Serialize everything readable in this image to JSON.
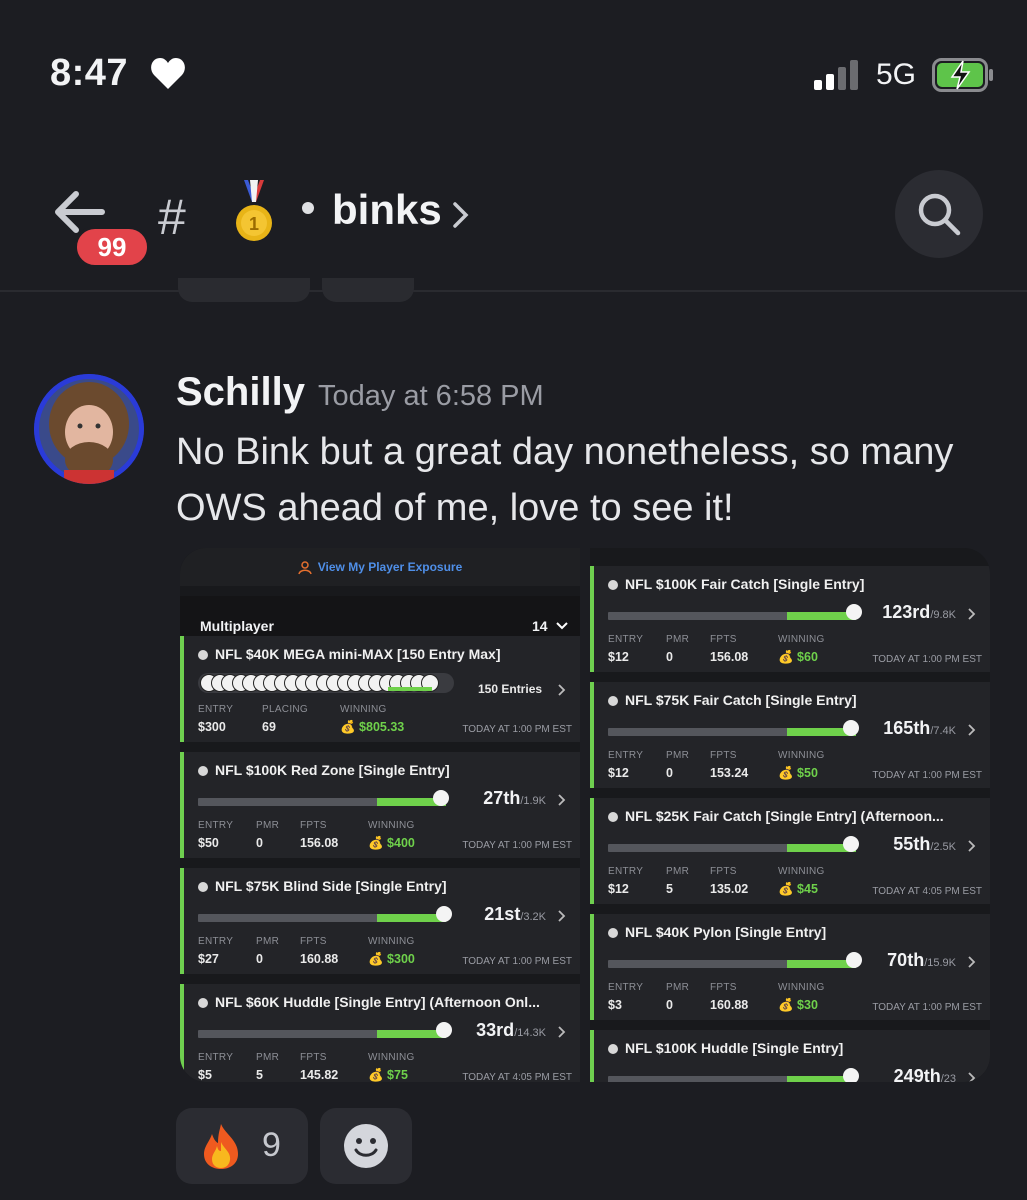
{
  "status_bar": {
    "time": "8:47",
    "network": "5G"
  },
  "header": {
    "unread_badge": "99",
    "hash": "#",
    "channel": "binks"
  },
  "message": {
    "author": "Schilly",
    "timestamp": "Today at 6:58 PM",
    "text": "No Bink but a great day nonetheless, so many OWS ahead of me, love to see it!"
  },
  "screenshot": {
    "exposure_link": "View My Player Exposure",
    "section_label": "Multiplayer",
    "section_count": "14",
    "left_cards": [
      {
        "title": "NFL $40K MEGA mini-MAX [150 Entry Max]",
        "entries": "150 Entries",
        "entry_label": "ENTRY",
        "entry": "$300",
        "mid_label": "PLACING",
        "mid": "69",
        "win_label": "WINNING",
        "winning": "💰 $805.33",
        "when": "TODAY AT 1:00 PM EST"
      },
      {
        "title": "NFL $100K Red Zone [Single Entry]",
        "rank": "27th",
        "field": "/1.9K",
        "progress": 0.98,
        "entry_label": "ENTRY",
        "entry": "$50",
        "pmr_label": "PMR",
        "pmr": "0",
        "fpts_label": "FPTS",
        "fpts": "156.08",
        "win_label": "WINNING",
        "winning": "💰 $400",
        "when": "TODAY AT 1:00 PM EST"
      },
      {
        "title": "NFL $75K Blind Side [Single Entry]",
        "rank": "21st",
        "field": "/3.2K",
        "progress": 0.99,
        "entry_label": "ENTRY",
        "entry": "$27",
        "pmr_label": "PMR",
        "pmr": "0",
        "fpts_label": "FPTS",
        "fpts": "160.88",
        "win_label": "WINNING",
        "winning": "💰 $300",
        "when": "TODAY AT 1:00 PM EST"
      },
      {
        "title": "NFL $60K Huddle [Single Entry] (Afternoon Onl...",
        "rank": "33rd",
        "field": "/14.3K",
        "progress": 0.99,
        "entry_label": "ENTRY",
        "entry": "$5",
        "pmr_label": "PMR",
        "pmr": "5",
        "fpts_label": "FPTS",
        "fpts": "145.82",
        "win_label": "WINNING",
        "winning": "💰 $75",
        "when": "TODAY AT 4:05 PM EST"
      }
    ],
    "right_cards": [
      {
        "title": "NFL $100K Fair Catch [Single Entry]",
        "rank": "123rd",
        "field": "/9.8K",
        "progress": 0.99,
        "entry_label": "ENTRY",
        "entry": "$12",
        "pmr_label": "PMR",
        "pmr": "0",
        "fpts_label": "FPTS",
        "fpts": "156.08",
        "win_label": "WINNING",
        "winning": "💰 $60",
        "when": "TODAY AT 1:00 PM EST"
      },
      {
        "title": "NFL $75K Fair Catch [Single Entry]",
        "rank": "165th",
        "field": "/7.4K",
        "progress": 0.98,
        "entry_label": "ENTRY",
        "entry": "$12",
        "pmr_label": "PMR",
        "pmr": "0",
        "fpts_label": "FPTS",
        "fpts": "153.24",
        "win_label": "WINNING",
        "winning": "💰 $50",
        "when": "TODAY AT 1:00 PM EST"
      },
      {
        "title": "NFL $25K Fair Catch [Single Entry] (Afternoon...",
        "rank": "55th",
        "field": "/2.5K",
        "progress": 0.98,
        "entry_label": "ENTRY",
        "entry": "$12",
        "pmr_label": "PMR",
        "pmr": "5",
        "fpts_label": "FPTS",
        "fpts": "135.02",
        "win_label": "WINNING",
        "winning": "💰 $45",
        "when": "TODAY AT 4:05 PM EST"
      },
      {
        "title": "NFL $40K Pylon [Single Entry]",
        "rank": "70th",
        "field": "/15.9K",
        "progress": 0.99,
        "entry_label": "ENTRY",
        "entry": "$3",
        "pmr_label": "PMR",
        "pmr": "0",
        "fpts_label": "FPTS",
        "fpts": "160.88",
        "win_label": "WINNING",
        "winning": "💰 $30",
        "when": "TODAY AT 1:00 PM EST"
      },
      {
        "title": "NFL $100K Huddle [Single Entry]",
        "rank": "249th",
        "field": "/23",
        "progress": 0.98
      }
    ]
  },
  "reactions": [
    {
      "emoji": "🔥",
      "count": "9"
    }
  ],
  "colors": {
    "background": "#1c1d22",
    "badge": "#e2434a",
    "accent_green": "#6fd14b",
    "link_blue": "#4f8fe8"
  }
}
